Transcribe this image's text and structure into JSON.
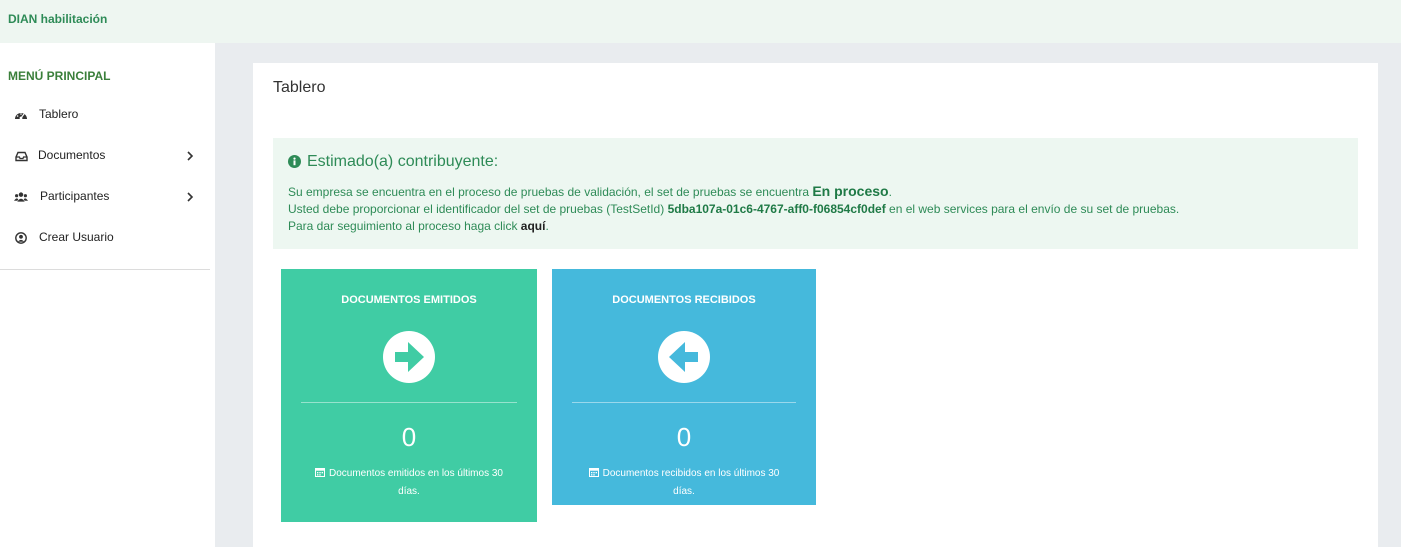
{
  "app": {
    "brand": "DIAN habilitación"
  },
  "sidebar": {
    "title": "MENÚ PRINCIPAL",
    "items": [
      {
        "label": "Tablero",
        "icon": "dashboard-icon",
        "has_submenu": false
      },
      {
        "label": "Documentos",
        "icon": "inbox-icon",
        "has_submenu": true
      },
      {
        "label": "Participantes",
        "icon": "users-icon",
        "has_submenu": true
      },
      {
        "label": "Crear Usuario",
        "icon": "user-circle-icon",
        "has_submenu": false
      }
    ]
  },
  "page": {
    "title": "Tablero"
  },
  "alert": {
    "heading": "Estimado(a) contribuyente:",
    "line1_prefix": "Su empresa se encuentra en el proceso de pruebas de validación, el set de pruebas se encuentra ",
    "line1_status": "En proceso",
    "line1_suffix": ".",
    "line2_prefix": "Usted debe proporcionar el identificador del set de pruebas (TestSetId) ",
    "line2_id": "5dba107a-01c6-4767-aff0-f06854cf0def",
    "line2_suffix": " en el web services para el envío de su set de pruebas.",
    "line3_prefix": "Para dar seguimiento al proceso haga click ",
    "line3_link": "aquí",
    "line3_suffix": "."
  },
  "tiles": [
    {
      "title": "DOCUMENTOS EMITIDOS",
      "count": "0",
      "footer": "Documentos emitidos en los últimos 30 días.",
      "color": "#40cca4",
      "icon": "arrow-right-circle-icon"
    },
    {
      "title": "DOCUMENTOS RECIBIDOS",
      "count": "0",
      "footer": "Documentos recibidos en los últimos 30 días.",
      "color": "#45b9dc",
      "icon": "arrow-left-circle-icon"
    }
  ],
  "colors": {
    "accent_green": "#2e8b57",
    "alert_bg": "#edf7f1",
    "topbar_bg": "#eef6f1",
    "content_bg": "#e9ecef"
  }
}
